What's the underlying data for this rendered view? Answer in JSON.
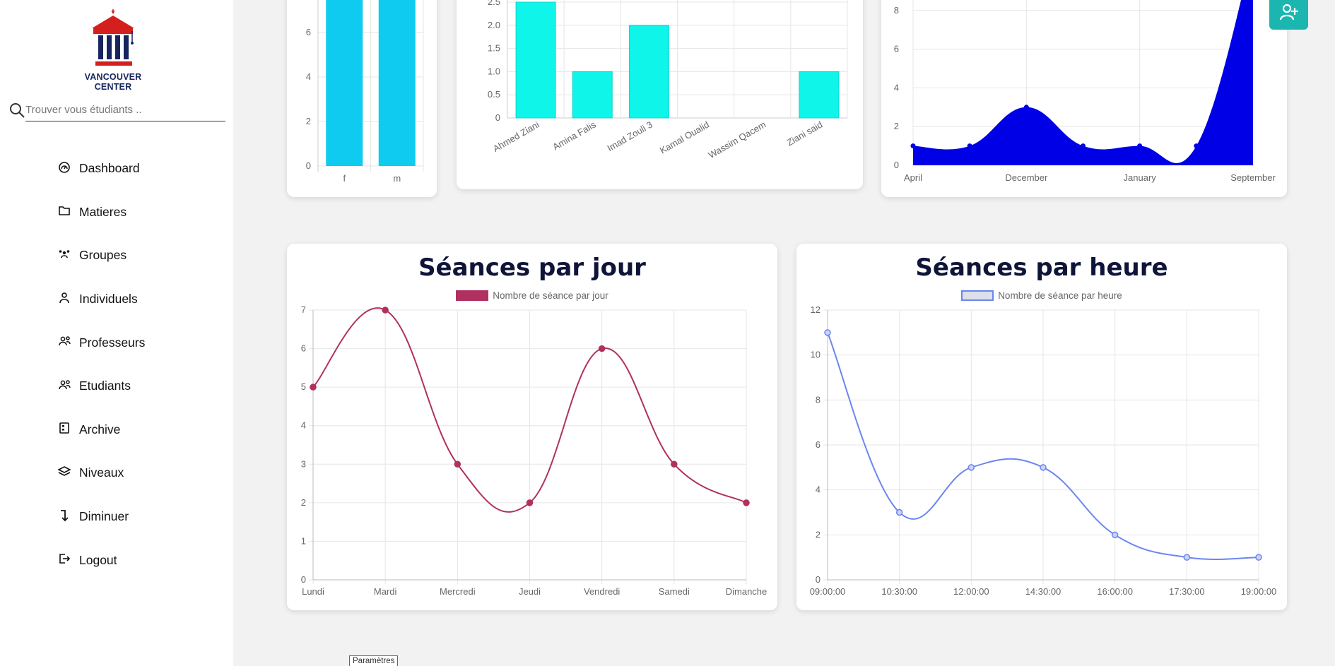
{
  "brand": {
    "name": "VANCOUVER CENTER"
  },
  "search": {
    "placeholder": "Trouver vous étudiants .."
  },
  "nav": [
    {
      "label": "Dashboard",
      "icon": "gauge-icon"
    },
    {
      "label": "Matieres",
      "icon": "folder-icon"
    },
    {
      "label": "Groupes",
      "icon": "group-icon"
    },
    {
      "label": "Individuels",
      "icon": "user-icon"
    },
    {
      "label": "Professeurs",
      "icon": "users-icon"
    },
    {
      "label": "Etudiants",
      "icon": "users-icon"
    },
    {
      "label": "Archive",
      "icon": "archive-icon"
    },
    {
      "label": "Niveaux",
      "icon": "layers-icon"
    },
    {
      "label": "Diminuer",
      "icon": "arrow-down-icon"
    },
    {
      "label": "Logout",
      "icon": "logout-icon"
    }
  ],
  "tooltip": "Paramètres",
  "colors": {
    "accent": "#1bb6b0",
    "gender_bar": "#0ecbef",
    "student_bar": "#0ff5ea",
    "area_fill": "#0000e6",
    "day_line": "#b03060",
    "hour_line": "#6b86f0"
  },
  "chart_data": [
    {
      "type": "bar",
      "categories": [
        "f",
        "m"
      ],
      "values": [
        7.5,
        7.5
      ],
      "y_ticks": [
        0,
        2,
        4,
        6
      ],
      "note": "partially visible (cropped at top)"
    },
    {
      "type": "bar",
      "categories": [
        "Ahmed Ziani",
        "Amina Falis",
        "Imad Zouli 3",
        "Kamal Oualid",
        "Wassim Qacem",
        "Ziani said"
      ],
      "values": [
        2.5,
        1,
        2,
        0,
        0,
        1
      ],
      "y_ticks": [
        "0",
        "0.5",
        "1.0",
        "1.5",
        "2.0",
        "2.5"
      ],
      "note": "partially visible (cropped at top)"
    },
    {
      "type": "area",
      "categories": [
        "April",
        "",
        "December",
        "",
        "January",
        "",
        "September"
      ],
      "x_labels": [
        "April",
        "December",
        "January",
        "September"
      ],
      "values": [
        1,
        1,
        3,
        1,
        1,
        1,
        11
      ],
      "y_ticks": [
        0,
        2,
        4,
        6,
        8
      ],
      "note": "partially visible (cropped at top)"
    },
    {
      "type": "line",
      "title": "Séances par jour",
      "series": [
        {
          "name": "Nombre de séance par jour",
          "values": [
            5,
            7,
            3,
            2,
            6,
            3,
            2
          ]
        }
      ],
      "categories": [
        "Lundi",
        "Mardi",
        "Mercredi",
        "Jeudi",
        "Vendredi",
        "Samedi",
        "Dimanche"
      ],
      "ylim": [
        0,
        7
      ],
      "y_ticks": [
        0,
        1,
        2,
        3,
        4,
        5,
        6,
        7
      ],
      "grid": true,
      "legend": "top-center"
    },
    {
      "type": "line",
      "title": "Séances par heure",
      "series": [
        {
          "name": "Nombre de séance par heure",
          "values": [
            11,
            3,
            5,
            5,
            2,
            1,
            1
          ]
        }
      ],
      "categories": [
        "09:00:00",
        "10:30:00",
        "12:00:00",
        "14:30:00",
        "16:00:00",
        "17:30:00",
        "19:00:00"
      ],
      "ylim": [
        0,
        12
      ],
      "y_ticks": [
        0,
        2,
        4,
        6,
        8,
        10,
        12
      ],
      "grid": true,
      "legend": "top-center"
    }
  ]
}
